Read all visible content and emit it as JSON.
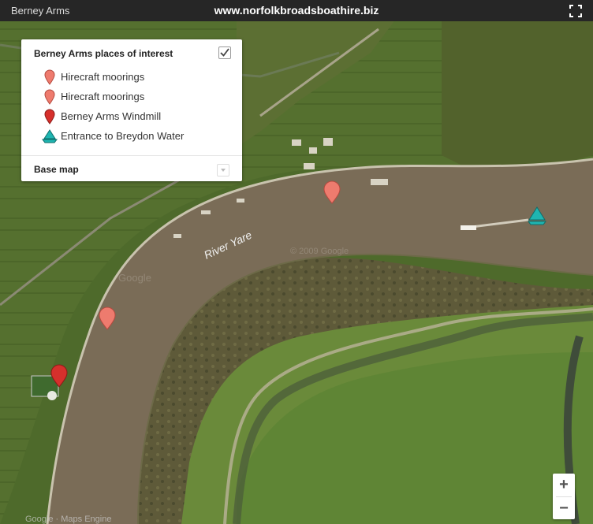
{
  "header": {
    "title": "Berney Arms",
    "site": "www.norfolkbroadsboathire.biz",
    "fullscreen_icon": "fullscreen-icon"
  },
  "legend": {
    "heading": "Berney Arms places of interest",
    "layer_checked": true,
    "items": [
      {
        "label": "Hirecraft moorings",
        "icon": "pin-icon",
        "color": "#ee7b6e"
      },
      {
        "label": "Hirecraft moorings",
        "icon": "pin-icon",
        "color": "#ee7b6e"
      },
      {
        "label": "Berney Arms Windmill",
        "icon": "pin-icon",
        "color": "#d6302c"
      },
      {
        "label": "Entrance to Breydon Water",
        "icon": "sailboat-icon",
        "color": "#1fb5b1"
      }
    ],
    "base_map_label": "Base map"
  },
  "map": {
    "river_label": "River Yare",
    "watermark": "Google",
    "watermark_2": "© 2009 Google",
    "attribution": "Google · Maps Engine"
  },
  "zoom": {
    "in": "+",
    "out": "−"
  }
}
